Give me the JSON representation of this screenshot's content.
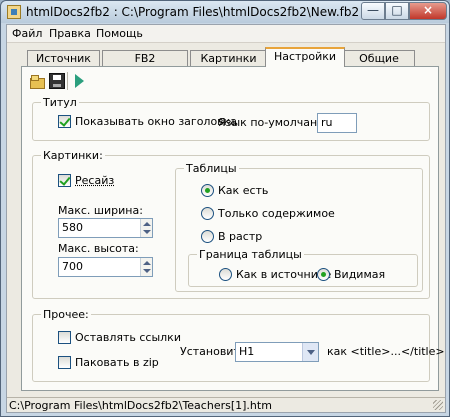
{
  "window": {
    "title": "htmlDocs2fb2 : C:\\Program Files\\htmlDocs2fb2\\New.fb2",
    "buttons": {
      "minimize": "—",
      "maximize": "□",
      "close": "×"
    }
  },
  "menu": [
    "Файл",
    "Правка",
    "Помощь"
  ],
  "tabs": [
    {
      "label": "Источник",
      "active": false
    },
    {
      "label": "FB2",
      "active": false
    },
    {
      "label": "Картинки",
      "active": false
    },
    {
      "label": "Настройки",
      "active": true
    },
    {
      "label": "Общие",
      "active": false
    }
  ],
  "toolbar": {
    "icons": [
      "open-icon",
      "save-icon",
      "run-icon"
    ]
  },
  "titul": {
    "legend": "Титул",
    "show_title_label": "Показывать окно заголовка",
    "show_title_checked": true,
    "lang_label": "Язык по-умолчанию:",
    "lang_value": "ru"
  },
  "pictures": {
    "legend": "Картинки:",
    "resize_label": "Ресайз",
    "resize_checked": true,
    "max_width_label": "Макс. ширина:",
    "max_width_value": "580",
    "max_height_label": "Макс. высота:",
    "max_height_value": "700"
  },
  "tables": {
    "legend": "Таблицы",
    "options": [
      "Как есть",
      "Только содержимое",
      "В растр"
    ],
    "selected": 0,
    "border_legend": "Граница таблицы",
    "border_options": [
      "Как в источнике",
      "Видимая"
    ],
    "border_selected": 1
  },
  "misc": {
    "legend": "Прочее:",
    "keep_links_label": "Оставлять ссылки",
    "keep_links_checked": false,
    "zip_label": "Паковать в zip",
    "zip_checked": false,
    "set_label": "Установить",
    "heading_value": "H1",
    "as_title_label": "как <title>...</title>"
  },
  "status": {
    "path": "C:\\Program Files\\htmlDocs2fb2\\Teachers[1].htm"
  },
  "colors": {
    "accent": "#e8a43a",
    "check": "#21a121",
    "panel": "#fbfbf8",
    "chrome": "#c7d6e4"
  }
}
